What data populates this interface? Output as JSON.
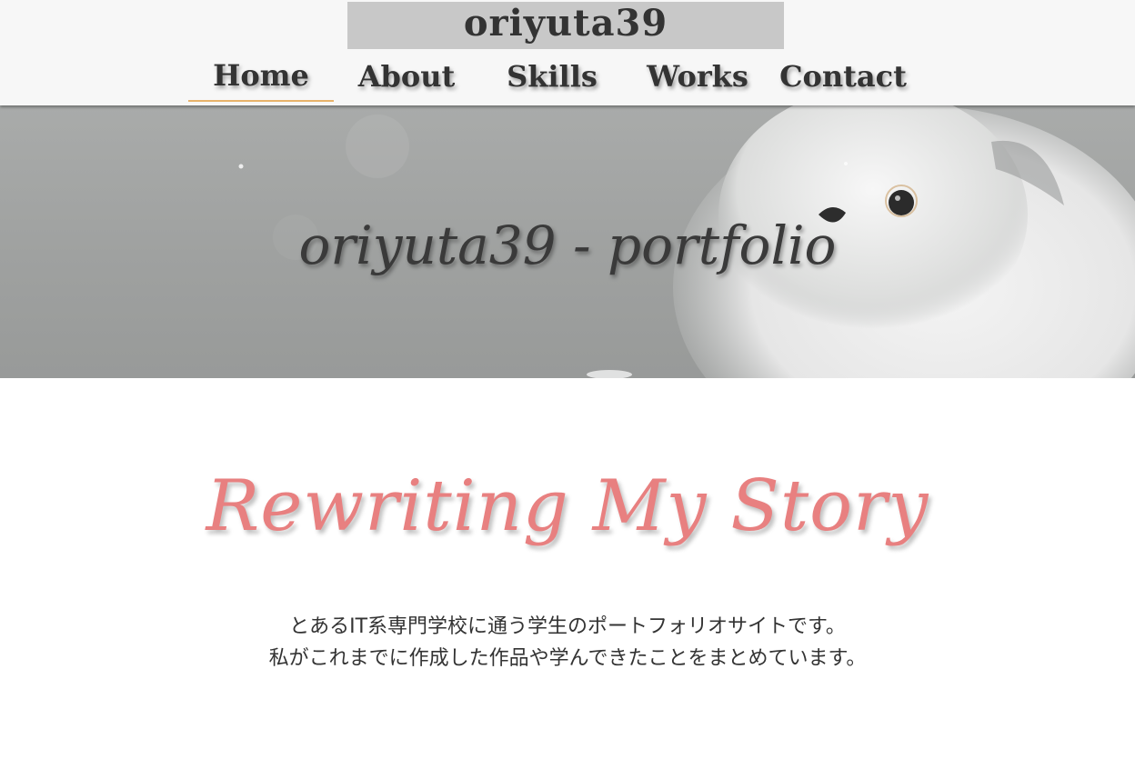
{
  "header": {
    "logo": "oriyuta39",
    "nav": [
      {
        "label": "Home",
        "active": true
      },
      {
        "label": "About",
        "active": false
      },
      {
        "label": "Skills",
        "active": false
      },
      {
        "label": "Works",
        "active": false
      },
      {
        "label": "Contact",
        "active": false
      }
    ],
    "active_underline_color": "#e8b36b"
  },
  "hero": {
    "title": "oriyuta39 - portfolio"
  },
  "main": {
    "tagline": "Rewriting My Story",
    "tagline_color": "#e88080",
    "description": [
      "とあるIT系専門学校に通う学生のポートフォリオサイトです。",
      "私がこれまでに作成した作品や学んできたことをまとめています。"
    ]
  }
}
